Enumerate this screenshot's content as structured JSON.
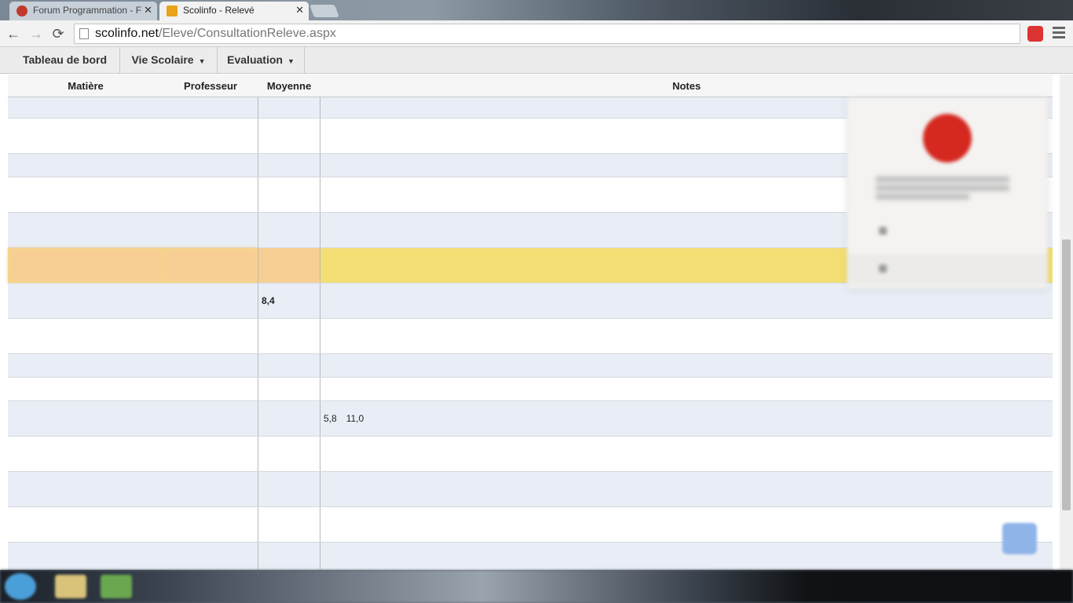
{
  "browser": {
    "tabs": [
      {
        "title": "Forum Programmation - F",
        "active": false,
        "favicon_color": "#c0392b"
      },
      {
        "title": "Scolinfo - Relevé",
        "active": true,
        "favicon_color": "#e8a317"
      }
    ],
    "close_glyph": "✕",
    "url_host": "scolinfo.net",
    "url_path": "/Eleve/ConsultationReleve.aspx",
    "icons": {
      "back": "←",
      "forward": "→",
      "reload": "⟳"
    }
  },
  "site_nav": {
    "items": [
      {
        "label": "Tableau de bord"
      },
      {
        "label": "Vie Scolaire",
        "caret": "▼"
      },
      {
        "label": "Evaluation",
        "caret": "▼"
      }
    ]
  },
  "table": {
    "headers": {
      "subject": "Matière",
      "teacher": "Professeur",
      "average": "Moyenne",
      "notes": "Notes"
    },
    "rows": [
      {
        "subject": "",
        "teacher": "",
        "average": "",
        "notes": []
      },
      {
        "subject": "",
        "teacher": "",
        "average": "",
        "notes": []
      },
      {
        "subject": "",
        "teacher": "",
        "average": "",
        "notes": []
      },
      {
        "subject": "",
        "teacher": "",
        "average": "",
        "notes": []
      },
      {
        "subject": "",
        "teacher": "",
        "average": "",
        "notes": []
      },
      {
        "subject": "",
        "teacher": "",
        "average": "",
        "notes": []
      },
      {
        "subject": "",
        "teacher": "",
        "average": "8,4",
        "notes": []
      },
      {
        "subject": "",
        "teacher": "",
        "average": "",
        "notes": []
      },
      {
        "subject": "",
        "teacher": "",
        "average": "",
        "notes": []
      },
      {
        "subject": "",
        "teacher": "",
        "average": "",
        "notes": []
      },
      {
        "subject": "",
        "teacher": "",
        "average": "",
        "notes": [
          "5,8",
          "11,0"
        ]
      },
      {
        "subject": "",
        "teacher": "",
        "average": "",
        "notes": []
      },
      {
        "subject": "",
        "teacher": "",
        "average": "",
        "notes": []
      },
      {
        "subject": "",
        "teacher": "",
        "average": "",
        "notes": []
      },
      {
        "subject": "",
        "teacher": "",
        "average": "",
        "notes": []
      }
    ]
  },
  "colors": {
    "highlight_row": "#f4df74",
    "odd_row": "#e9eef6",
    "teacher_text": "#f0a070",
    "stop_badge": "#d5281f"
  }
}
